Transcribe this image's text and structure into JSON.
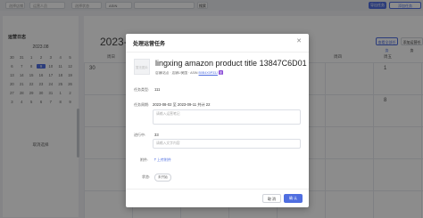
{
  "topbar": {
    "filters": [
      "选择店铺",
      "运营人员",
      "选择状态"
    ],
    "search_type": "ASIN",
    "search_button": "搜索",
    "new_task_button": "添加任务",
    "right_buttons": [
      "导出任务",
      "添加任务"
    ]
  },
  "sidebar": {
    "title": "运营日志",
    "month_label": "2023.08",
    "weekdays": [
      "日",
      "一",
      "二",
      "三",
      "四",
      "五",
      "六"
    ],
    "days": [
      "30",
      "31",
      "1",
      "2",
      "3",
      "4",
      "5",
      "6",
      "7",
      "8",
      "9",
      "10",
      "11",
      "12",
      "13",
      "14",
      "15",
      "16",
      "17",
      "18",
      "19",
      "20",
      "21",
      "22",
      "23",
      "24",
      "25",
      "26",
      "27",
      "28",
      "29",
      "30",
      "31",
      "1",
      "2",
      "3",
      "4",
      "5",
      "6",
      "7",
      "8",
      "9"
    ],
    "today": "9",
    "footer": "取消选择"
  },
  "main": {
    "title": "2023-08",
    "buttons": [
      "查看全部任务",
      "添加运营任务"
    ],
    "weekday_labels": [
      "周日",
      "周一",
      "周二",
      "周三",
      "周四",
      "周五"
    ],
    "visible_dates": [
      "30",
      "1",
      "8"
    ]
  },
  "modal": {
    "title": "处理运营任务",
    "close_icon": "close-icon",
    "product": {
      "thumb_alt": "暂无图片",
      "title": "lingxing amazon product title 13847C6D01",
      "meta_prefix": "店铺/站点 · 店铺1/美国 · ASIN",
      "asin_link": "B0B4X0P33J",
      "tag": "亚"
    },
    "fields": {
      "task_type_label": "任务类型:",
      "task_type_value": "111",
      "task_time_label": "任务周期:",
      "task_time_value": "2023-08-02 至 2023-09-11 共计 22",
      "remark_placeholder": "请输入运营笔记",
      "progress_label": "进行中:",
      "progress_value": "33",
      "progress_placeholder": "请输入文字内容",
      "attachment_label": "附件:",
      "upload_text": "上传附件",
      "status_label": "状态:",
      "status_value": "未开始"
    },
    "footer": {
      "cancel": "取 消",
      "ok": "确 认"
    }
  }
}
